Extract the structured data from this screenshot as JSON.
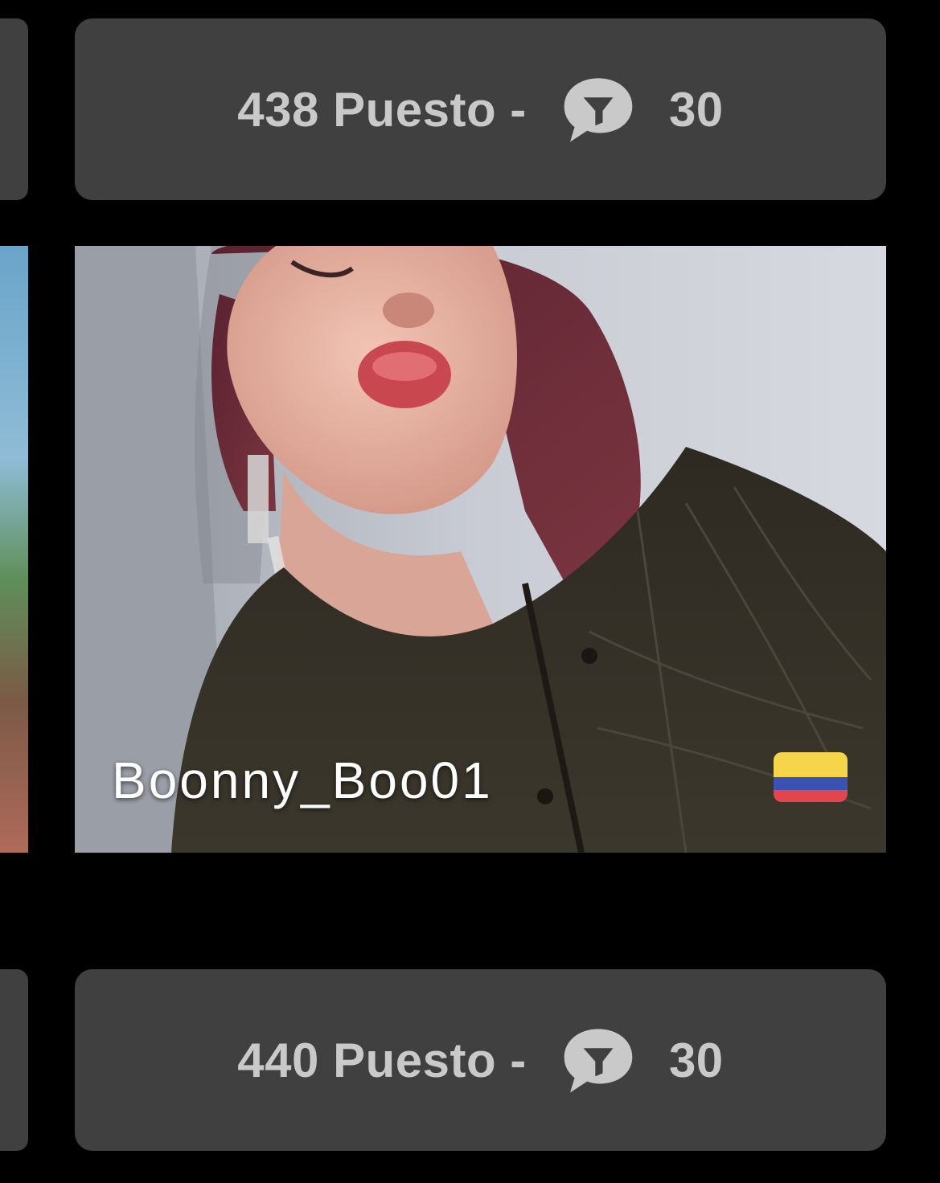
{
  "rank_cards": [
    {
      "rank_label": "438 Puesto - ",
      "icon": "chat-bubble-icon",
      "count": "30"
    },
    {
      "rank_label": "440 Puesto - ",
      "icon": "chat-bubble-icon",
      "count": "30"
    }
  ],
  "profile": {
    "username": "Boonny_Boo01",
    "country_flag": "colombia-flag-icon",
    "flag_colors": {
      "yellow": "#f7d54a",
      "blue": "#3a52b4",
      "red": "#e2464c"
    }
  },
  "colors": {
    "background": "#000000",
    "card": "#404040",
    "text": "#c9c9c9"
  }
}
